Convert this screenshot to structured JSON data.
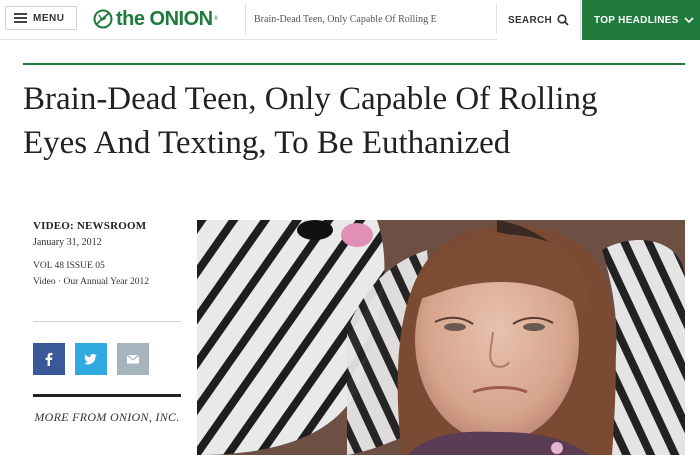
{
  "nav": {
    "menu_label": "MENU",
    "menu_icon": "hamburger-icon",
    "logo_text": "the ONION",
    "logo_mark": "®",
    "search_value": "Brain-Dead Teen, Only Capable Of Rolling E",
    "search_label": "SEARCH",
    "search_icon": "magnifier-icon",
    "headlines_label": "TOP HEADLINES",
    "headlines_icon": "chevron-down-icon",
    "brand_color": "#1f7a3c"
  },
  "article": {
    "headline": "Brain-Dead Teen, Only Capable Of Rolling Eyes And Texting, To Be Euthanized",
    "category": "VIDEO: NEWSROOM",
    "date": "January 31, 2012",
    "issue": "VOL 48 ISSUE 05",
    "series": "Video · Our Annual Year 2012"
  },
  "share": {
    "facebook_icon": "facebook-icon",
    "twitter_icon": "twitter-icon",
    "email_icon": "email-icon",
    "colors": {
      "facebook": "#3b5998",
      "twitter": "#2fa9e0",
      "email": "#a6b4bd"
    }
  },
  "more": {
    "label": "MORE FROM ONION, INC."
  }
}
